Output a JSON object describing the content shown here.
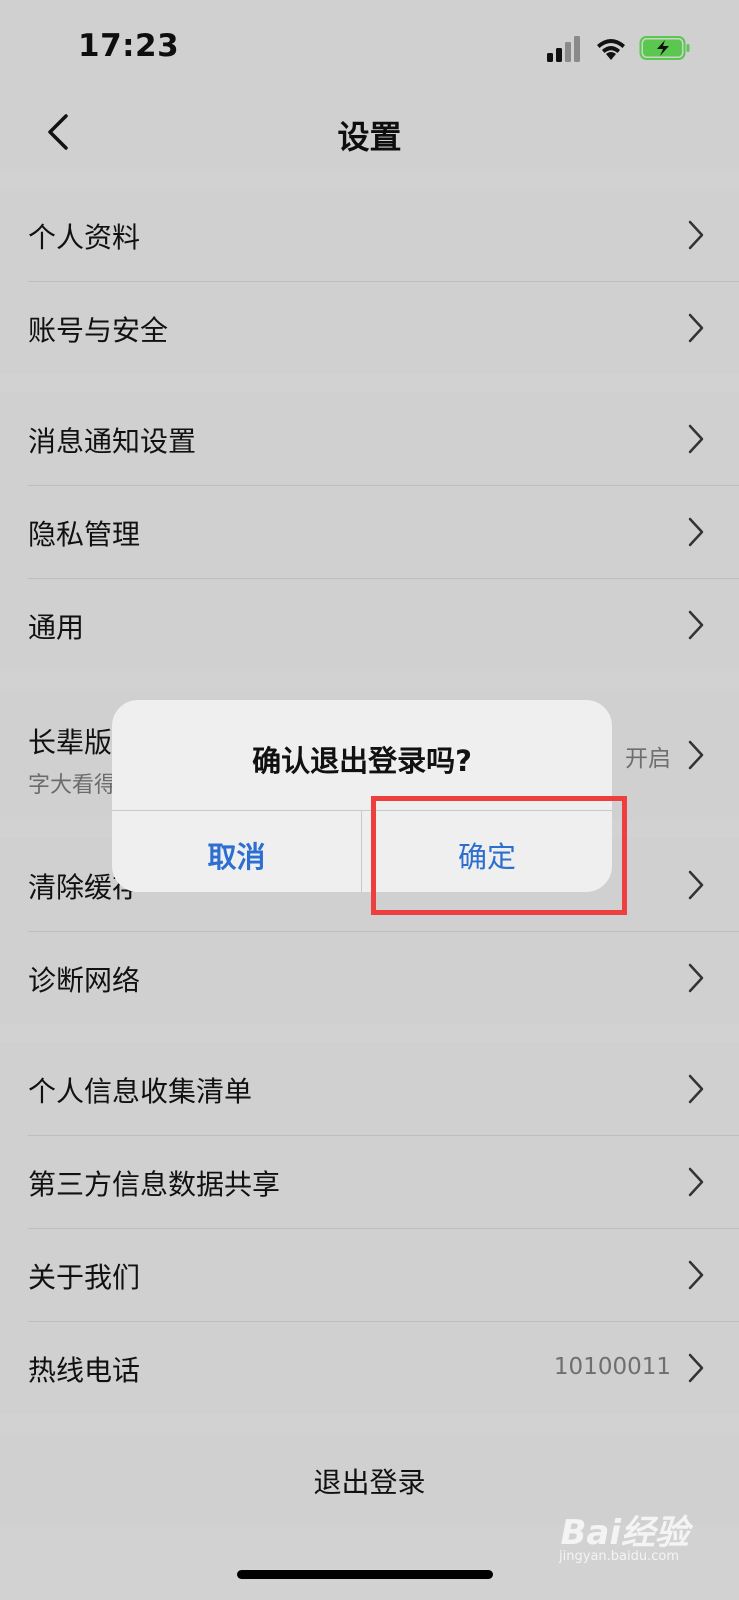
{
  "status_bar": {
    "time": "17:23",
    "icons": [
      "cellular-signal-icon",
      "wifi-icon",
      "battery-charging-icon"
    ],
    "battery_color": "#5ac84e"
  },
  "nav": {
    "title": "设置",
    "back_icon": "chevron-left-icon"
  },
  "groups": [
    {
      "items": [
        {
          "label": "个人资料"
        },
        {
          "label": "账号与安全"
        }
      ]
    },
    {
      "items": [
        {
          "label": "消息通知设置"
        },
        {
          "label": "隐私管理"
        },
        {
          "label": "通用"
        }
      ]
    },
    {
      "items": [
        {
          "label": "长辈版",
          "subtitle": "字大看得清",
          "value": "开启"
        }
      ]
    },
    {
      "items": [
        {
          "label": "清除缓存"
        },
        {
          "label": "诊断网络"
        }
      ]
    },
    {
      "items": [
        {
          "label": "个人信息收集清单"
        },
        {
          "label": "第三方信息数据共享"
        },
        {
          "label": "关于我们"
        },
        {
          "label": "热线电话",
          "value": "10100011"
        }
      ]
    }
  ],
  "logout_label": "退出登录",
  "dialog": {
    "title": "确认退出登录吗?",
    "cancel_label": "取消",
    "confirm_label": "确定"
  },
  "colors": {
    "dialog_button": "#2c6fd1",
    "highlight": "#ee3f3f"
  },
  "watermark": {
    "brand": "Bai经验",
    "url": "jingyan.baidu.com"
  }
}
